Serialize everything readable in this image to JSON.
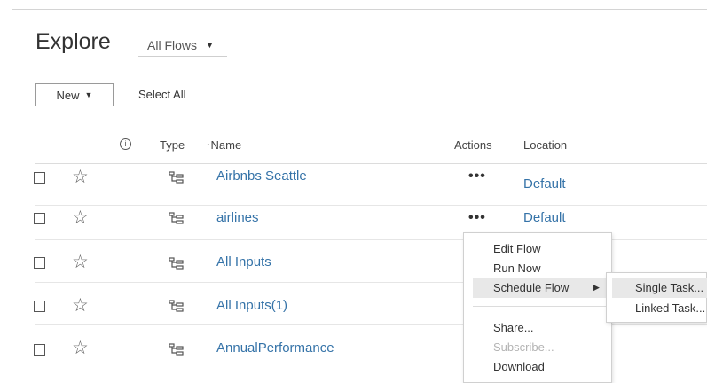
{
  "header": {
    "title": "Explore",
    "filter_value": "All Flows",
    "new_label": "New",
    "select_all_label": "Select All"
  },
  "columns": {
    "info": "i",
    "type": "Type",
    "name": "Name",
    "actions": "Actions",
    "location": "Location"
  },
  "rows": [
    {
      "name": "Airbnbs Seattle",
      "actions": "•••",
      "location": "Default"
    },
    {
      "name": "airlines",
      "actions": "•••",
      "location": "Default"
    },
    {
      "name": "All Inputs"
    },
    {
      "name": "All Inputs(1)"
    },
    {
      "name": "AnnualPerformance"
    }
  ],
  "context_menu": {
    "items": [
      "Edit Flow",
      "Run Now",
      "Schedule Flow"
    ],
    "items_after_separator": [
      "Share...",
      "Subscribe...",
      "Download"
    ],
    "disabled": [
      "Subscribe..."
    ]
  },
  "submenu": {
    "items": [
      "Single Task...",
      "Linked Task..."
    ]
  },
  "icons": {
    "filter_caret": "caret-down-icon",
    "new_caret": "caret-down-icon",
    "sort": "sort-ascending-icon",
    "info": "info-circle-icon",
    "favorite": "star-outline-icon",
    "type": "flow-icon",
    "submenu_arrow": "caret-right-icon"
  },
  "colors": {
    "link": "#3573a8",
    "highlight": "#e8e8e8",
    "disabled_text": "#b4b4b4"
  }
}
